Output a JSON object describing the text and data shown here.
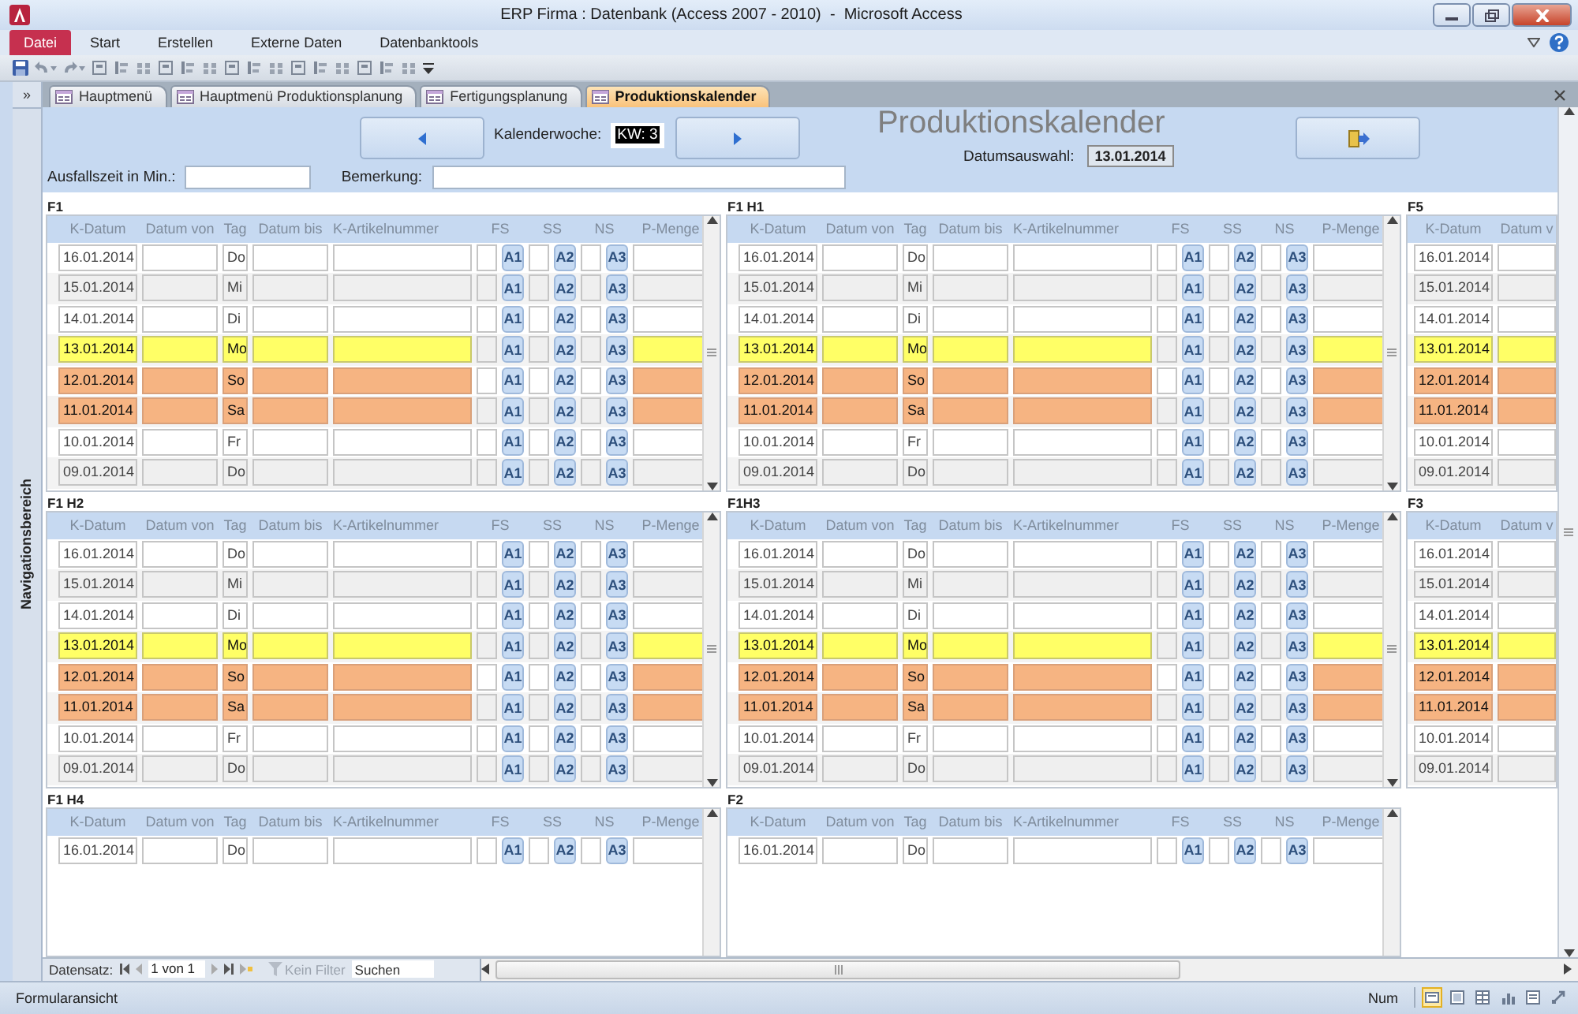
{
  "window": {
    "title": "ERP Firma : Datenbank (Access 2007 - 2010)  -  Microsoft Access"
  },
  "ribbon_tabs": [
    {
      "label": "Datei",
      "kind": "file"
    },
    {
      "label": "Start",
      "kind": "tab"
    },
    {
      "label": "Erstellen",
      "kind": "tab"
    },
    {
      "label": "Externe Daten",
      "kind": "tab"
    },
    {
      "label": "Datenbanktools",
      "kind": "tab"
    }
  ],
  "navigation_pane": {
    "toggle": "»",
    "label": "Navigationsbereich"
  },
  "document_tabs": [
    {
      "label": "Hauptmenü",
      "selected": false
    },
    {
      "label": "Hauptmenü Produktionsplanung",
      "selected": false
    },
    {
      "label": "Fertigungsplanung",
      "selected": false
    },
    {
      "label": "Produktionskalender",
      "selected": true
    }
  ],
  "form_header": {
    "week_label": "Kalenderwoche:",
    "week_value": "KW: 3",
    "week_value_highlighted": true,
    "title": "Produktionskalender",
    "date_label": "Datumsauswahl:",
    "date_value": "13.01.2014",
    "downtime_label": "Ausfallszeit in Min.:",
    "remark_label": "Bemerkung:"
  },
  "subforms": [
    {
      "label": "F1",
      "columns": [
        "K-Datum",
        "Datum von",
        "Tag",
        "Datum bis",
        "K-Artikelnummer",
        "FS",
        "SS",
        "NS",
        "P-Menge"
      ],
      "rows": [
        {
          "k_datum": "16.01.2014",
          "tag": "Do",
          "kind": "plain",
          "buttons": [
            "A1",
            "A2",
            "A3"
          ]
        },
        {
          "k_datum": "15.01.2014",
          "tag": "Mi",
          "kind": "plain",
          "buttons": [
            "A1",
            "A2",
            "A3"
          ]
        },
        {
          "k_datum": "14.01.2014",
          "tag": "Di",
          "kind": "plain",
          "buttons": [
            "A1",
            "A2",
            "A3"
          ]
        },
        {
          "k_datum": "13.01.2014",
          "tag": "Mo",
          "kind": "today",
          "buttons": [
            "A1",
            "A2",
            "A3"
          ]
        },
        {
          "k_datum": "12.01.2014",
          "tag": "So",
          "kind": "weekend",
          "buttons": [
            "A1",
            "A2",
            "A3"
          ]
        },
        {
          "k_datum": "11.01.2014",
          "tag": "Sa",
          "kind": "weekend",
          "buttons": [
            "A1",
            "A2",
            "A3"
          ]
        },
        {
          "k_datum": "10.01.2014",
          "tag": "Fr",
          "kind": "plain",
          "buttons": [
            "A1",
            "A2",
            "A3"
          ]
        },
        {
          "k_datum": "09.01.2014",
          "tag": "Do",
          "kind": "plain",
          "buttons": [
            "A1",
            "A2",
            "A3"
          ]
        }
      ]
    },
    {
      "label": "F1 H1",
      "columns": [
        "K-Datum",
        "Datum von",
        "Tag",
        "Datum bis",
        "K-Artikelnummer",
        "FS",
        "SS",
        "NS",
        "P-Menge"
      ],
      "rows": [
        {
          "k_datum": "16.01.2014",
          "tag": "Do",
          "kind": "plain",
          "buttons": [
            "A1",
            "A2",
            "A3"
          ]
        },
        {
          "k_datum": "15.01.2014",
          "tag": "Mi",
          "kind": "plain",
          "buttons": [
            "A1",
            "A2",
            "A3"
          ]
        },
        {
          "k_datum": "14.01.2014",
          "tag": "Di",
          "kind": "plain",
          "buttons": [
            "A1",
            "A2",
            "A3"
          ]
        },
        {
          "k_datum": "13.01.2014",
          "tag": "Mo",
          "kind": "today",
          "buttons": [
            "A1",
            "A2",
            "A3"
          ]
        },
        {
          "k_datum": "12.01.2014",
          "tag": "So",
          "kind": "weekend",
          "buttons": [
            "A1",
            "A2",
            "A3"
          ]
        },
        {
          "k_datum": "11.01.2014",
          "tag": "Sa",
          "kind": "weekend",
          "buttons": [
            "A1",
            "A2",
            "A3"
          ]
        },
        {
          "k_datum": "10.01.2014",
          "tag": "Fr",
          "kind": "plain",
          "buttons": [
            "A1",
            "A2",
            "A3"
          ]
        },
        {
          "k_datum": "09.01.2014",
          "tag": "Do",
          "kind": "plain",
          "buttons": [
            "A1",
            "A2",
            "A3"
          ]
        }
      ]
    },
    {
      "label": "F5",
      "columns": [
        "K-Datum",
        "Datum v"
      ],
      "rows": [
        {
          "k_datum": "16.01.2014",
          "kind": "plain"
        },
        {
          "k_datum": "15.01.2014",
          "kind": "plain"
        },
        {
          "k_datum": "14.01.2014",
          "kind": "plain"
        },
        {
          "k_datum": "13.01.2014",
          "kind": "today"
        },
        {
          "k_datum": "12.01.2014",
          "kind": "weekend"
        },
        {
          "k_datum": "11.01.2014",
          "kind": "weekend"
        },
        {
          "k_datum": "10.01.2014",
          "kind": "plain"
        },
        {
          "k_datum": "09.01.2014",
          "kind": "plain"
        }
      ]
    },
    {
      "label": "F1 H2",
      "columns": [
        "K-Datum",
        "Datum von",
        "Tag",
        "Datum bis",
        "K-Artikelnummer",
        "FS",
        "SS",
        "NS",
        "P-Menge"
      ],
      "rows": [
        {
          "k_datum": "16.01.2014",
          "tag": "Do",
          "kind": "plain",
          "buttons": [
            "A1",
            "A2",
            "A3"
          ]
        },
        {
          "k_datum": "15.01.2014",
          "tag": "Mi",
          "kind": "plain",
          "buttons": [
            "A1",
            "A2",
            "A3"
          ]
        },
        {
          "k_datum": "14.01.2014",
          "tag": "Di",
          "kind": "plain",
          "buttons": [
            "A1",
            "A2",
            "A3"
          ]
        },
        {
          "k_datum": "13.01.2014",
          "tag": "Mo",
          "kind": "today",
          "buttons": [
            "A1",
            "A2",
            "A3"
          ]
        },
        {
          "k_datum": "12.01.2014",
          "tag": "So",
          "kind": "weekend",
          "buttons": [
            "A1",
            "A2",
            "A3"
          ]
        },
        {
          "k_datum": "11.01.2014",
          "tag": "Sa",
          "kind": "weekend",
          "buttons": [
            "A1",
            "A2",
            "A3"
          ]
        },
        {
          "k_datum": "10.01.2014",
          "tag": "Fr",
          "kind": "plain",
          "buttons": [
            "A1",
            "A2",
            "A3"
          ]
        },
        {
          "k_datum": "09.01.2014",
          "tag": "Do",
          "kind": "plain",
          "buttons": [
            "A1",
            "A2",
            "A3"
          ]
        }
      ]
    },
    {
      "label": "F1H3",
      "columns": [
        "K-Datum",
        "Datum von",
        "Tag",
        "Datum bis",
        "K-Artikelnummer",
        "FS",
        "SS",
        "NS",
        "P-Menge"
      ],
      "rows": [
        {
          "k_datum": "16.01.2014",
          "tag": "Do",
          "kind": "plain",
          "buttons": [
            "A1",
            "A2",
            "A3"
          ]
        },
        {
          "k_datum": "15.01.2014",
          "tag": "Mi",
          "kind": "plain",
          "buttons": [
            "A1",
            "A2",
            "A3"
          ]
        },
        {
          "k_datum": "14.01.2014",
          "tag": "Di",
          "kind": "plain",
          "buttons": [
            "A1",
            "A2",
            "A3"
          ]
        },
        {
          "k_datum": "13.01.2014",
          "tag": "Mo",
          "kind": "today",
          "buttons": [
            "A1",
            "A2",
            "A3"
          ]
        },
        {
          "k_datum": "12.01.2014",
          "tag": "So",
          "kind": "weekend",
          "buttons": [
            "A1",
            "A2",
            "A3"
          ]
        },
        {
          "k_datum": "11.01.2014",
          "tag": "Sa",
          "kind": "weekend",
          "buttons": [
            "A1",
            "A2",
            "A3"
          ]
        },
        {
          "k_datum": "10.01.2014",
          "tag": "Fr",
          "kind": "plain",
          "buttons": [
            "A1",
            "A2",
            "A3"
          ]
        },
        {
          "k_datum": "09.01.2014",
          "tag": "Do",
          "kind": "plain",
          "buttons": [
            "A1",
            "A2",
            "A3"
          ]
        }
      ]
    },
    {
      "label": "F3",
      "columns": [
        "K-Datum",
        "Datum v"
      ],
      "rows": [
        {
          "k_datum": "16.01.2014",
          "kind": "plain"
        },
        {
          "k_datum": "15.01.2014",
          "kind": "plain"
        },
        {
          "k_datum": "14.01.2014",
          "kind": "plain"
        },
        {
          "k_datum": "13.01.2014",
          "kind": "today"
        },
        {
          "k_datum": "12.01.2014",
          "kind": "weekend"
        },
        {
          "k_datum": "11.01.2014",
          "kind": "weekend"
        },
        {
          "k_datum": "10.01.2014",
          "kind": "plain"
        },
        {
          "k_datum": "09.01.2014",
          "kind": "plain"
        }
      ]
    },
    {
      "label": "F1 H4",
      "columns": [
        "K-Datum",
        "Datum von",
        "Tag",
        "Datum bis",
        "K-Artikelnummer",
        "FS",
        "SS",
        "NS",
        "P-Menge"
      ],
      "rows": [
        {
          "k_datum": "16.01.2014",
          "tag": "Do",
          "kind": "plain",
          "buttons": [
            "A1",
            "A2",
            "A3"
          ]
        }
      ]
    },
    {
      "label": "F2",
      "columns": [
        "K-Datum",
        "Datum von",
        "Tag",
        "Datum bis",
        "K-Artikelnummer",
        "FS",
        "SS",
        "NS",
        "P-Menge"
      ],
      "rows": [
        {
          "k_datum": "16.01.2014",
          "tag": "Do",
          "kind": "plain",
          "buttons": [
            "A1",
            "A2",
            "A3"
          ]
        }
      ]
    }
  ],
  "record_navigation": {
    "label": "Datensatz:",
    "position": "1 von 1",
    "filter": "Kein Filter",
    "search_placeholder": "Suchen"
  },
  "status_bar": {
    "view": "Formularansicht",
    "num": "Num",
    "view_buttons": [
      {
        "selected": true
      },
      {
        "selected": false
      },
      {
        "selected": false
      },
      {
        "selected": false
      },
      {
        "selected": false
      },
      {
        "selected": false
      }
    ]
  }
}
